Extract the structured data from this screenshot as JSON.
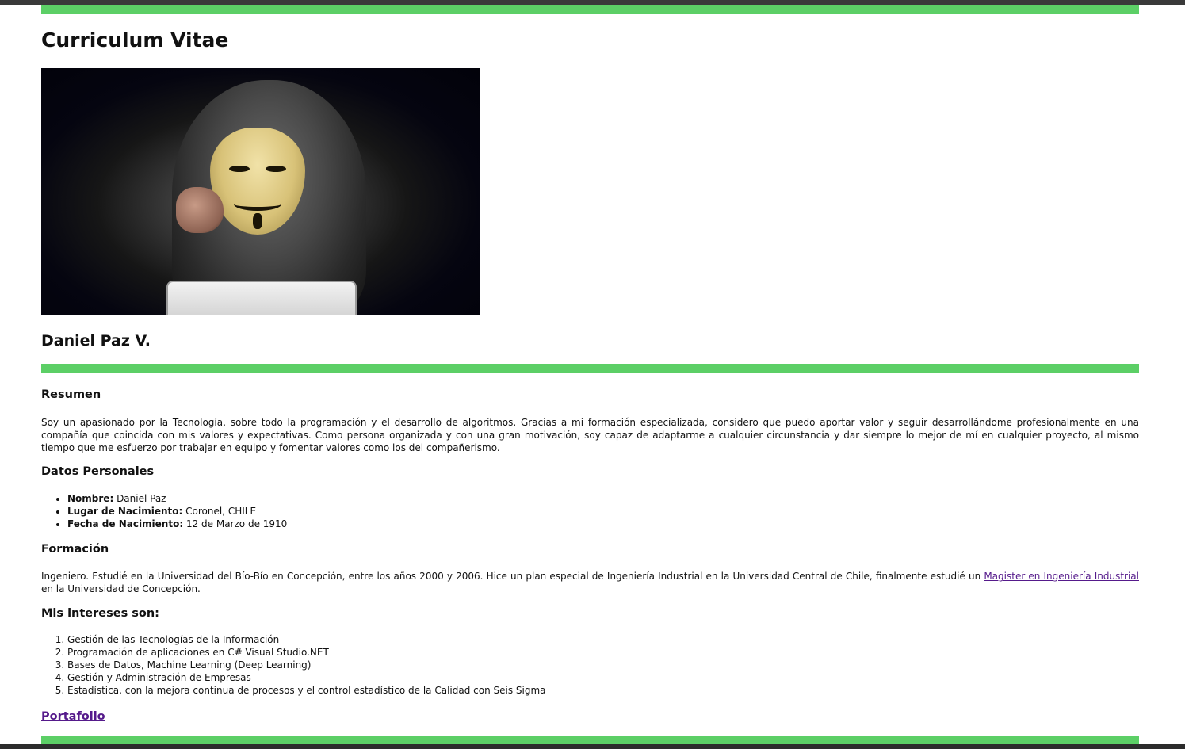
{
  "header": {
    "title": "Curriculum Vitae"
  },
  "profile": {
    "name": "Daniel Paz V."
  },
  "resumen": {
    "title": "Resumen",
    "text": "Soy un apasionado por la Tecnología, sobre todo la programación y el desarrollo de algoritmos. Gracias a mi formación especializada, considero que puedo aportar valor y seguir desarrollándome profesionalmente en una compañía que coincida con mis valores y expectativas. Como persona organizada y con una gran motivación, soy capaz de adaptarme a cualquier circunstancia y dar siempre lo mejor de mí en cualquier proyecto, al mismo tiempo que me esfuerzo por trabajar en equipo y fomentar valores como los del compañerismo."
  },
  "datos": {
    "title": "Datos Personales",
    "items": [
      {
        "label": "Nombre:",
        "value": " Daniel Paz"
      },
      {
        "label": "Lugar de Nacimiento:",
        "value": " Coronel, CHILE"
      },
      {
        "label": "Fecha de Nacimiento:",
        "value": " 12 de Marzo de 1910"
      }
    ]
  },
  "formacion": {
    "title": "Formación",
    "text_before": "Ingeniero. Estudié en la Universidad del Bío-Bío en Concepción, entre los años 2000 y 2006. Hice un plan especial de Ingeniería Industrial en la Universidad Central de Chile, finalmente estudié un ",
    "link_text": "Magister en Ingeniería Industrial",
    "text_after": " en la Universidad de Concepción."
  },
  "intereses": {
    "title": "Mis intereses son:",
    "items": [
      "Gestión de las Tecnologías de la Información",
      "Programación de aplicaciones en C# Visual Studio.NET",
      "Bases de Datos, Machine Learning (Deep Learning)",
      "Gestión y Administración de Empresas",
      "Estadística, con la mejora continua de procesos y el control estadístico de la Calidad con Seis Sigma"
    ]
  },
  "footer": {
    "portfolio_link": "Portafolio"
  },
  "colors": {
    "accent_bar": "#5ccf66",
    "link": "#551a8b"
  },
  "photo": {
    "icon": "hooded-anonymous-mask-figure"
  }
}
